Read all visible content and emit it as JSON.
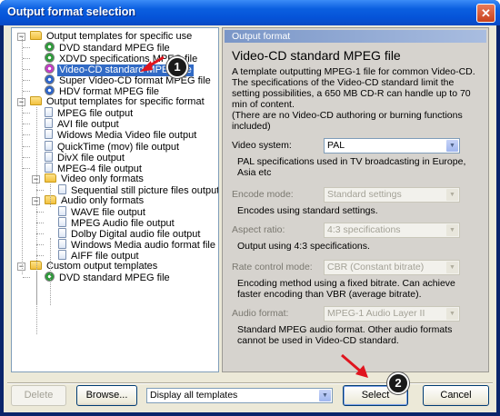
{
  "window": {
    "title": "Output format selection",
    "close_glyph": "✕"
  },
  "tree": {
    "items": [
      {
        "label": "Output templates for specific use",
        "icon": "folder-icon",
        "level": 0,
        "expander": "−"
      },
      {
        "label": "DVD standard MPEG file",
        "icon": "disc-icon",
        "color": "#2e9a3a",
        "level": 1
      },
      {
        "label": "XDVD specifications MPEG file",
        "icon": "disc-icon",
        "color": "#2e9a3a",
        "level": 1
      },
      {
        "label": "Video-CD standard MPEG file",
        "icon": "disc-icon",
        "color": "#c23cc4",
        "level": 1,
        "selected": true
      },
      {
        "label": "Super Video-CD format MPEG file",
        "icon": "disc-icon",
        "color": "#2d64c8",
        "level": 1
      },
      {
        "label": "HDV format MPEG file",
        "icon": "disc-icon",
        "color": "#2d64c8",
        "level": 1
      },
      {
        "label": "Output templates for specific format",
        "icon": "folder-icon",
        "level": 0,
        "expander": "−"
      },
      {
        "label": "MPEG file output",
        "icon": "file-icon",
        "level": 1
      },
      {
        "label": "AVI file output",
        "icon": "file-icon",
        "level": 1
      },
      {
        "label": "Widows Media Video file output",
        "icon": "file-icon",
        "level": 1
      },
      {
        "label": "QuickTime (mov) file output",
        "icon": "file-icon",
        "level": 1
      },
      {
        "label": "DivX file output",
        "icon": "file-icon",
        "level": 1
      },
      {
        "label": "MPEG-4 file output",
        "icon": "file-icon",
        "level": 1
      },
      {
        "label": "Video only formats",
        "icon": "folder-icon",
        "level": 1,
        "expander": "−"
      },
      {
        "label": "Sequential still picture files output",
        "icon": "file-icon",
        "level": 2
      },
      {
        "label": "Audio only formats",
        "icon": "folder-icon",
        "level": 1,
        "expander": "−"
      },
      {
        "label": "WAVE file output",
        "icon": "file-icon",
        "level": 2
      },
      {
        "label": "MPEG Audio file output",
        "icon": "file-icon",
        "level": 2
      },
      {
        "label": "Dolby Digital audio file output",
        "icon": "file-icon",
        "level": 2
      },
      {
        "label": "Windows Media audio format file",
        "icon": "file-icon",
        "level": 2
      },
      {
        "label": "AIFF file output",
        "icon": "file-icon",
        "level": 2
      },
      {
        "label": "Custom output templates",
        "icon": "folder-icon",
        "level": 0,
        "expander": "−"
      },
      {
        "label": "DVD standard MPEG file",
        "icon": "disc-icon",
        "color": "#2e9a3a",
        "level": 1
      }
    ]
  },
  "panel": {
    "header": "Output format",
    "title": "Video-CD standard MPEG file",
    "description": "A template outputting MPEG-1 file for common Video-CD. The specifications of the Video-CD standard limit the setting possibilities, a 650 MB CD-R can handle up to 70 min of content.\n(There are no Video-CD authoring or burning functions included)",
    "fields": [
      {
        "label": "Video system:",
        "value": "PAL",
        "enabled": true,
        "desc": "PAL specifications used in TV broadcasting in Europe, Asia etc"
      },
      {
        "label": "Encode mode:",
        "value": "Standard settings",
        "enabled": false,
        "desc": "Encodes using standard settings."
      },
      {
        "label": "Aspect ratio:",
        "value": "4:3 specifications",
        "enabled": false,
        "desc": "Output using 4:3 specifications."
      },
      {
        "label": "Rate control mode:",
        "value": "CBR (Constant bitrate)",
        "enabled": false,
        "desc": "Encoding method using a fixed bitrate. Can achieve faster encoding than VBR (average bitrate)."
      },
      {
        "label": "Audio format:",
        "value": "MPEG-1 Audio Layer II",
        "enabled": false,
        "desc": "Standard MPEG audio format. Other audio formats cannot be used in Video-CD standard."
      }
    ]
  },
  "footer": {
    "delete_label": "Delete",
    "browse_label": "Browse...",
    "filter_value": "Display all templates",
    "select_label": "Select",
    "cancel_label": "Cancel"
  },
  "annotations": {
    "badge_1": "1",
    "badge_2": "2",
    "arrow_color": "#e0141e"
  },
  "colors": {
    "accent": "#316ac5",
    "title_bar": "#0553d8"
  }
}
